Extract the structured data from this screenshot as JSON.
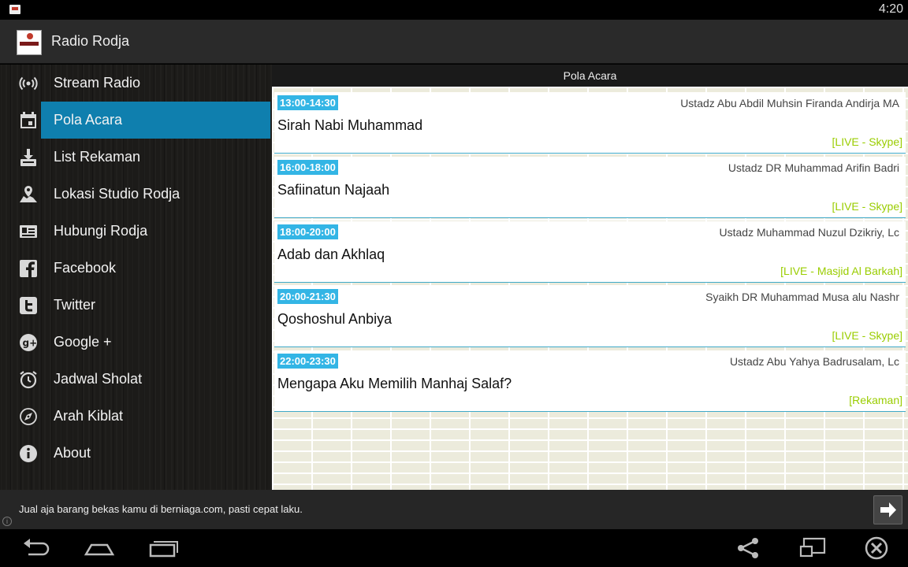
{
  "status": {
    "time": "4:20"
  },
  "app": {
    "title": "Radio Rodja"
  },
  "sidebar": {
    "items": [
      {
        "label": "Stream Radio",
        "icon": "radio-signal-icon"
      },
      {
        "label": "Pola Acara",
        "icon": "calendar-icon",
        "active": true
      },
      {
        "label": "List Rekaman",
        "icon": "download-icon"
      },
      {
        "label": "Lokasi Studio Rodja",
        "icon": "map-icon"
      },
      {
        "label": "Hubungi Rodja",
        "icon": "contact-card-icon"
      },
      {
        "label": "Facebook",
        "icon": "facebook-icon"
      },
      {
        "label": "Twitter",
        "icon": "twitter-icon"
      },
      {
        "label": "Google +",
        "icon": "google-plus-icon"
      },
      {
        "label": "Jadwal Sholat",
        "icon": "alarm-clock-icon"
      },
      {
        "label": "Arah Kiblat",
        "icon": "compass-icon"
      },
      {
        "label": "About",
        "icon": "info-icon"
      }
    ]
  },
  "schedule": {
    "title": "Pola Acara",
    "items": [
      {
        "time": "13:00-14:30",
        "speaker": "Ustadz Abu Abdil Muhsin Firanda Andirja MA",
        "title": "Sirah Nabi Muhammad",
        "note": "[LIVE - Skype]"
      },
      {
        "time": "16:00-18:00",
        "speaker": "Ustadz DR Muhammad Arifin Badri",
        "title": "Safiinatun Najaah",
        "note": "[LIVE - Skype]"
      },
      {
        "time": "18:00-20:00",
        "speaker": "Ustadz Muhammad Nuzul Dzikriy, Lc",
        "title": "Adab dan Akhlaq",
        "note": "[LIVE - Masjid Al Barkah]"
      },
      {
        "time": "20:00-21:30",
        "speaker": "Syaikh DR Muhammad Musa alu Nashr",
        "title": "Qoshoshul Anbiya",
        "note": "[LIVE - Skype]"
      },
      {
        "time": "22:00-23:30",
        "speaker": "Ustadz Abu Yahya Badrusalam, Lc",
        "title": "Mengapa Aku Memilih Manhaj Salaf?",
        "note": "[Rekaman]"
      }
    ]
  },
  "ad": {
    "text": "Jual aja barang bekas kamu di berniaga.com, pasti cepat laku.",
    "info": "i"
  },
  "navbar": {
    "icons": [
      "back-icon",
      "home-icon",
      "recent-apps-icon",
      "share-icon",
      "screen-icon",
      "close-circle-icon"
    ]
  },
  "colors": {
    "accent": "#0f7fae",
    "time_badge": "#33b5e5",
    "note": "#9acd00",
    "divider": "#3fa9c8"
  }
}
